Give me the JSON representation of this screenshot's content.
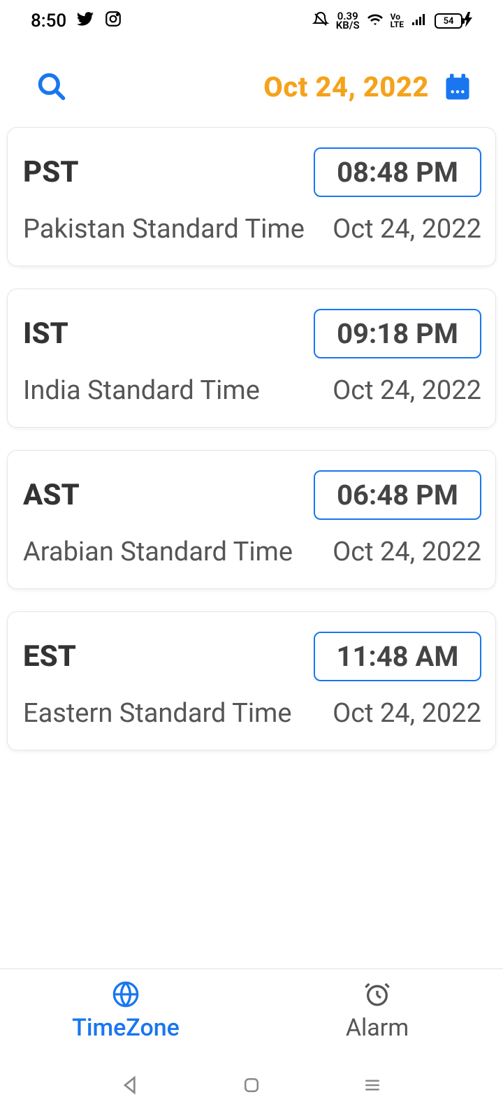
{
  "status": {
    "time": "8:50",
    "network_speed_top": "0.39",
    "network_speed_bottom": "KB/S",
    "volte": "Vo LTE",
    "battery": "54"
  },
  "header": {
    "date": "Oct 24, 2022"
  },
  "timezones": [
    {
      "abbr": "PST",
      "name": "Pakistan Standard Time",
      "time": "08:48 PM",
      "date": "Oct 24, 2022"
    },
    {
      "abbr": "IST",
      "name": "India Standard Time",
      "time": "09:18 PM",
      "date": "Oct 24, 2022"
    },
    {
      "abbr": "AST",
      "name": "Arabian Standard Time",
      "time": "06:48 PM",
      "date": "Oct 24, 2022"
    },
    {
      "abbr": "EST",
      "name": "Eastern Standard Time",
      "time": "11:48 AM",
      "date": "Oct 24, 2022"
    }
  ],
  "tabs": {
    "timezone_label": "TimeZone",
    "alarm_label": "Alarm"
  }
}
